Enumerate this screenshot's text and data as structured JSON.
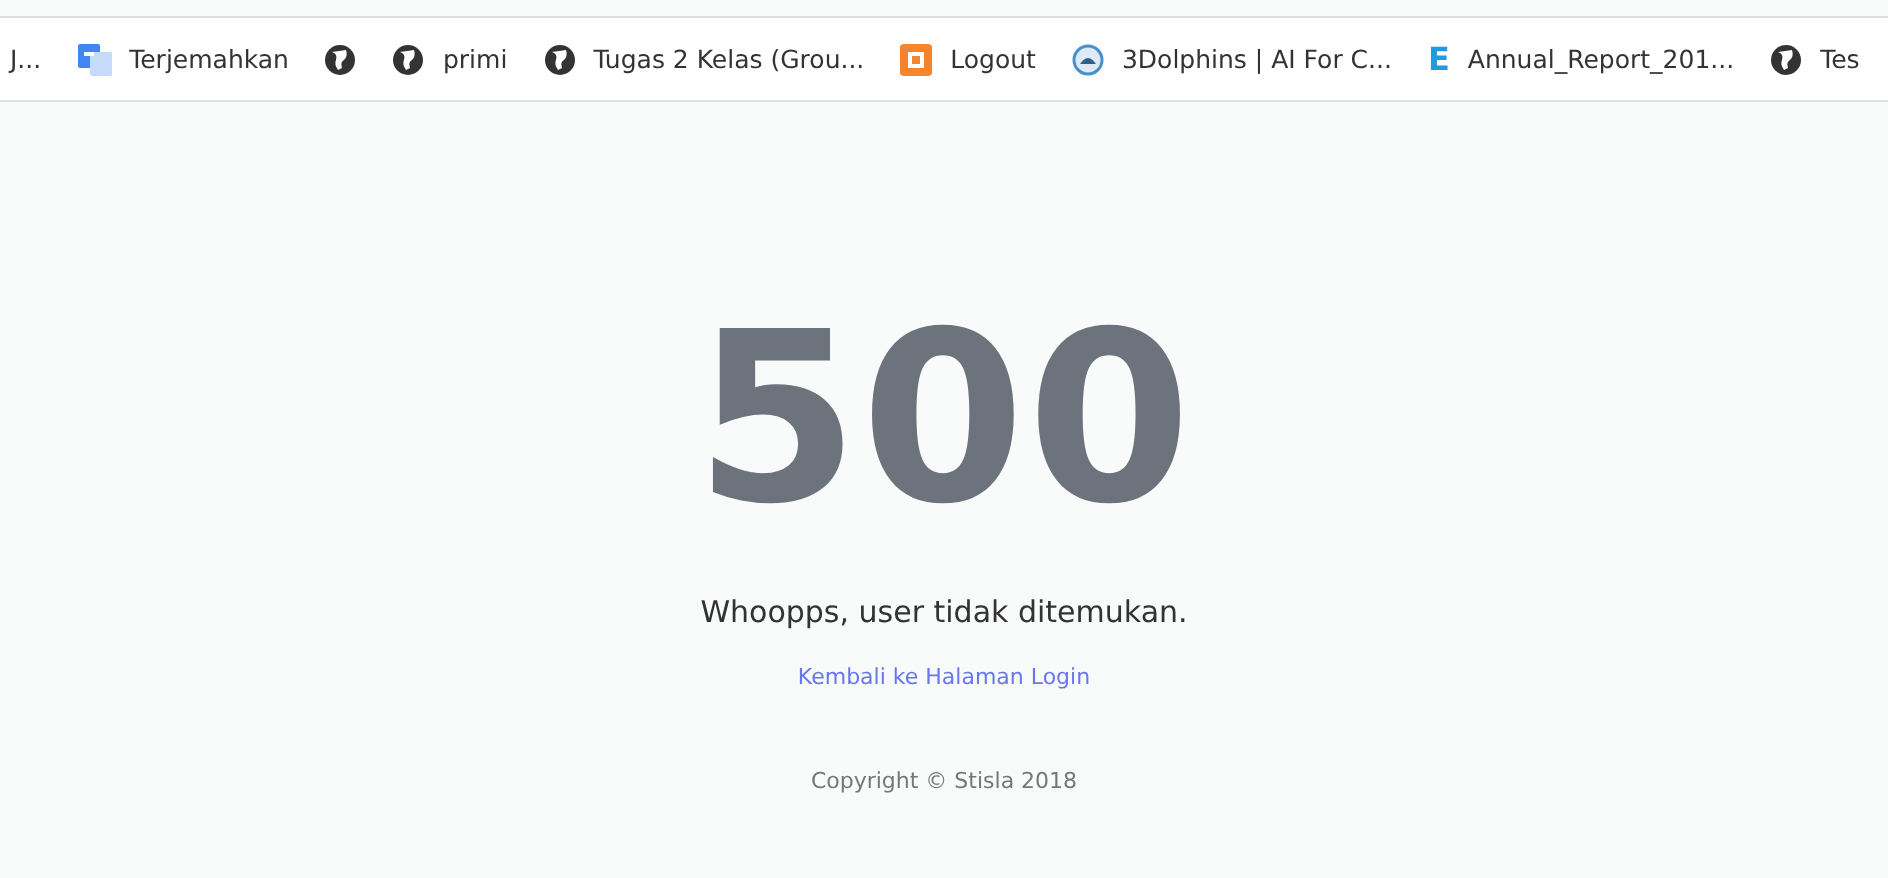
{
  "bookmarks": [
    {
      "kind": "none",
      "label": "J..."
    },
    {
      "kind": "translate",
      "label": "Terjemahkan"
    },
    {
      "kind": "globe"
    },
    {
      "kind": "globe",
      "label": "primi"
    },
    {
      "kind": "globe",
      "label": "Tugas 2 Kelas (Grou..."
    },
    {
      "kind": "xampp",
      "label": "Logout"
    },
    {
      "kind": "circle",
      "label": "3Dolphins | AI For C..."
    },
    {
      "kind": "letter",
      "icon_text": "E",
      "label": "Annual_Report_201..."
    },
    {
      "kind": "globe",
      "label": "Tes"
    }
  ],
  "error": {
    "code": "500",
    "message": "Whoopps, user tidak ditemukan.",
    "link": "Kembali ke Halaman Login"
  },
  "footer": "Copyright © Stisla 2018"
}
